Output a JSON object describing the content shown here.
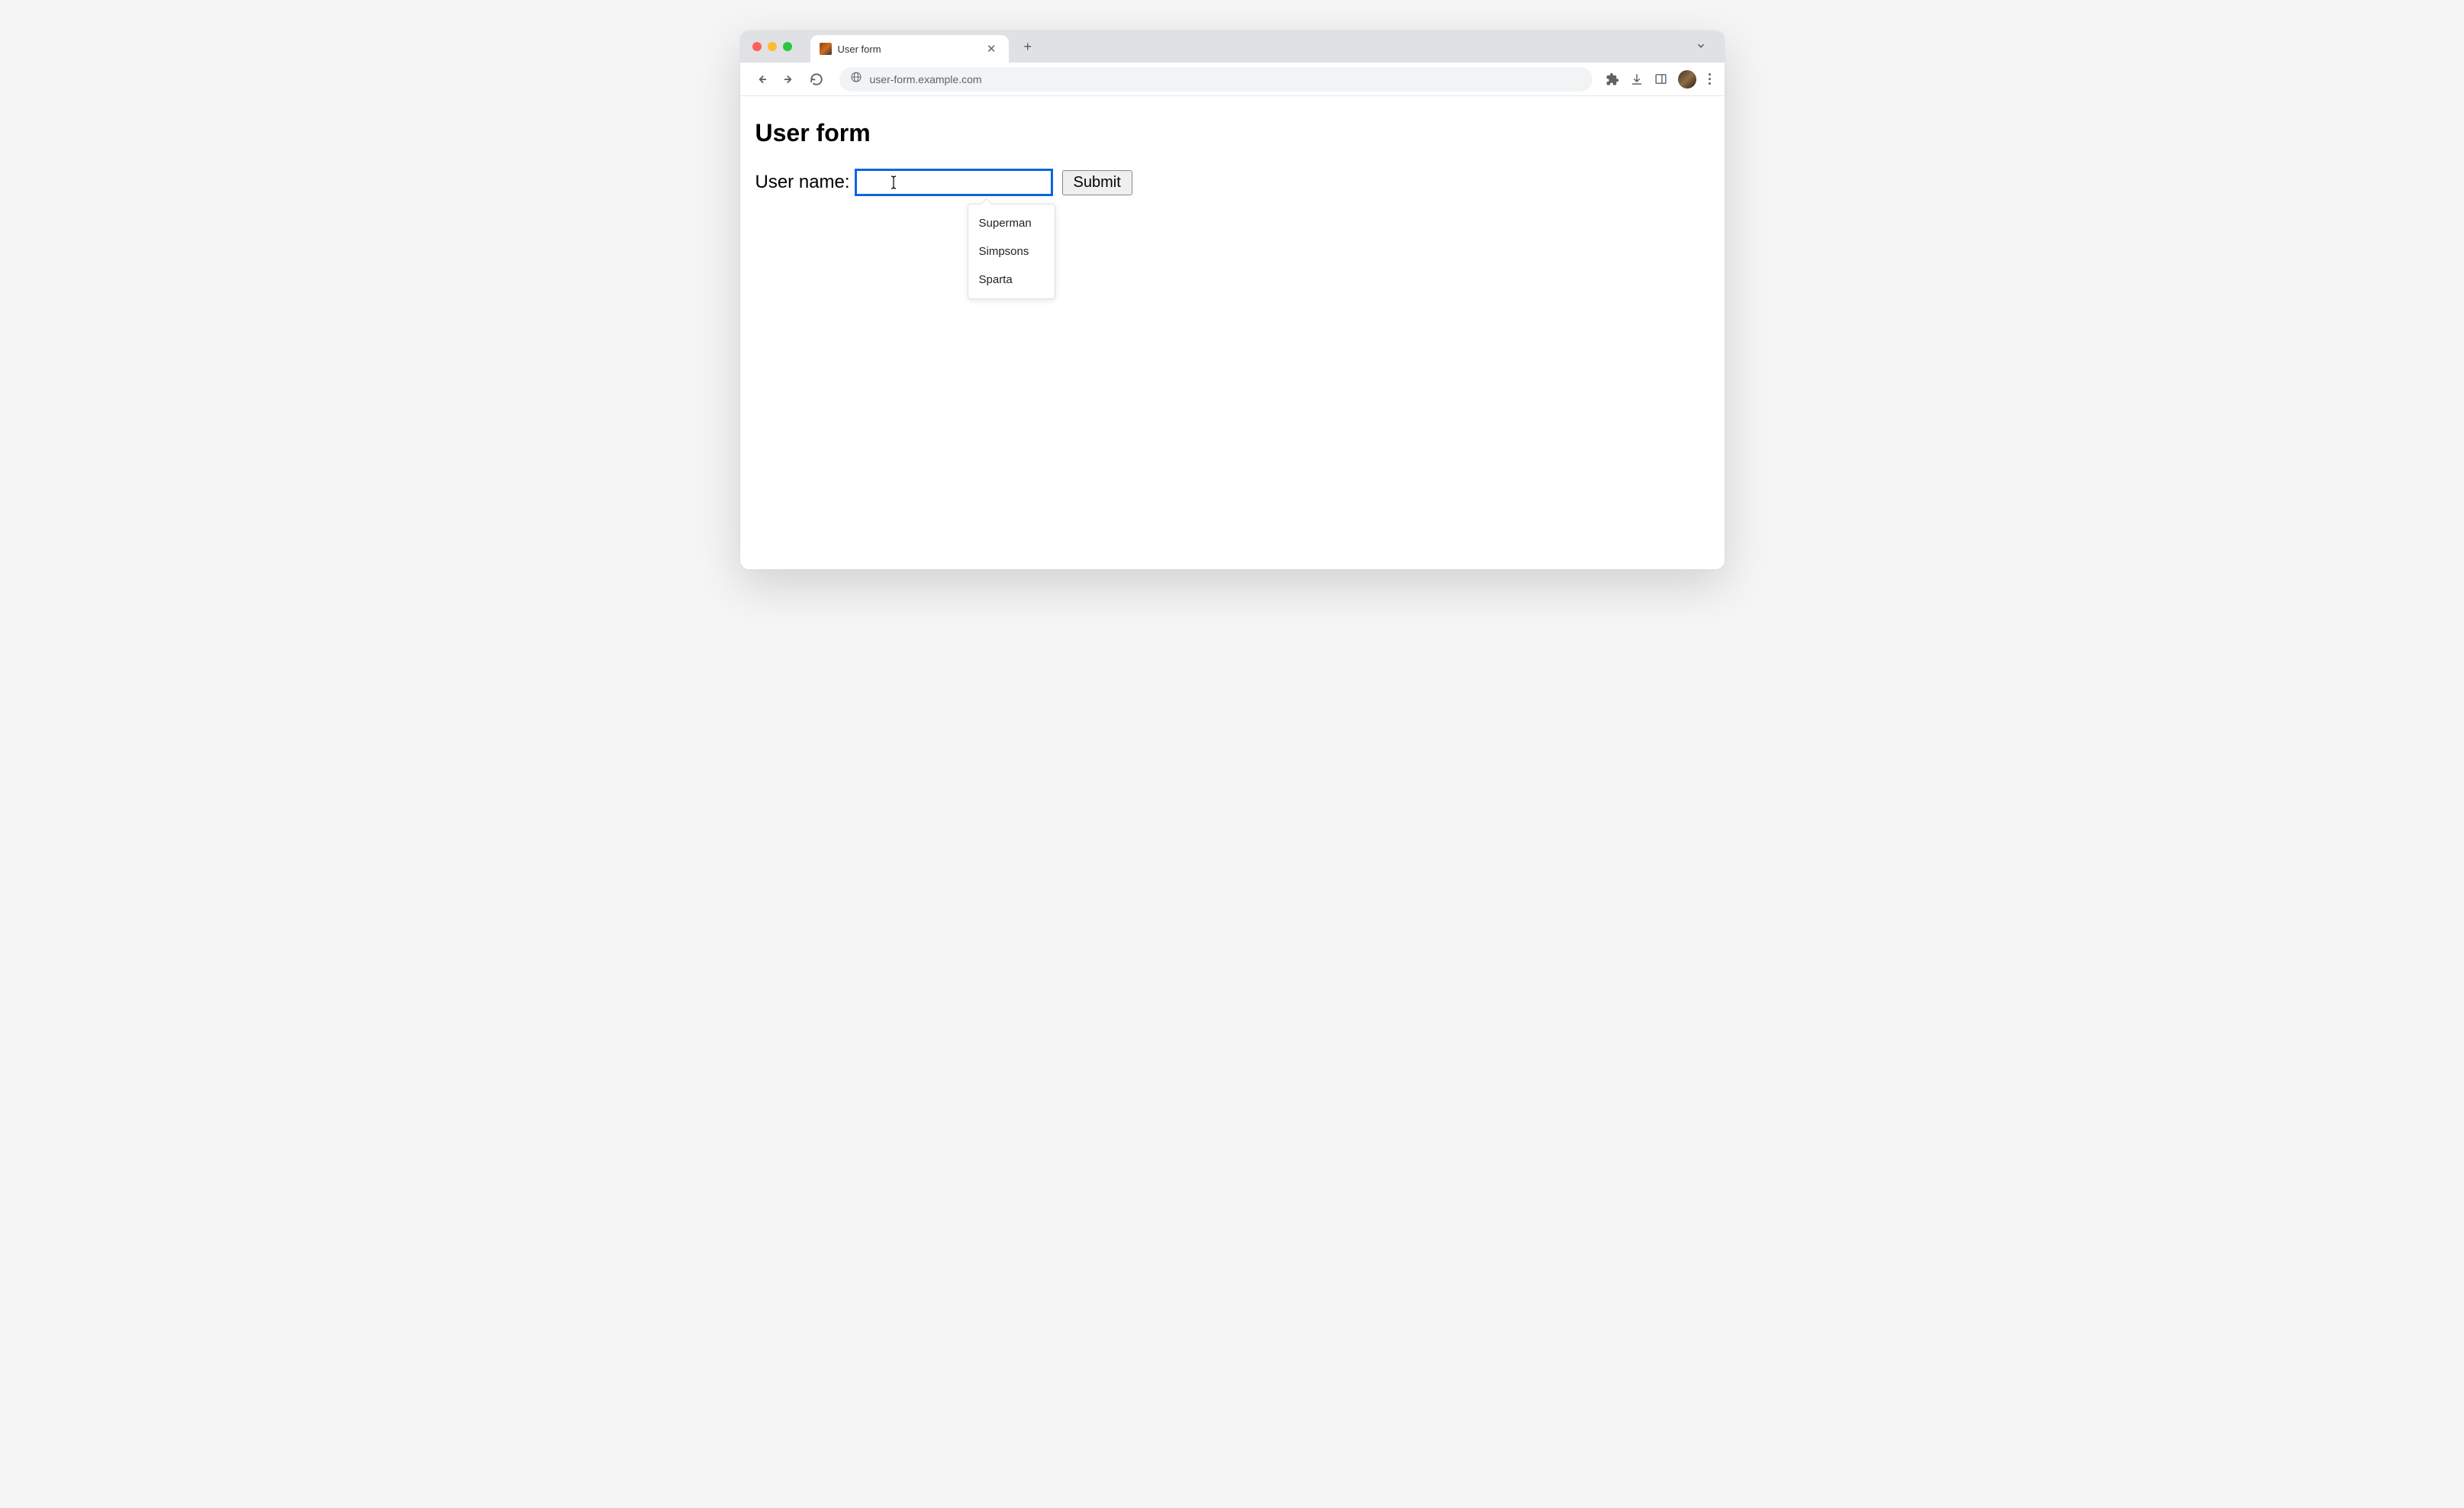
{
  "browser": {
    "tab": {
      "title": "User form"
    },
    "url": "user-form.example.com"
  },
  "page": {
    "heading": "User form",
    "form": {
      "label": "User name:",
      "input_value": "",
      "submit_label": "Submit"
    },
    "autocomplete": {
      "items": [
        "Superman",
        "Simpsons",
        "Sparta"
      ]
    }
  }
}
